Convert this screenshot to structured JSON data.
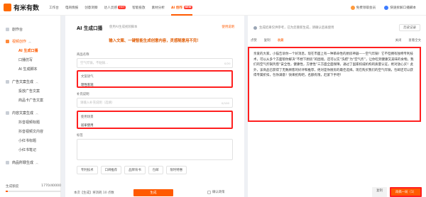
{
  "app": {
    "logo_text": "有米有数",
    "brand_color": "#ff5a00"
  },
  "nav": [
    {
      "label": "工作台"
    },
    {
      "label": "电商情报"
    },
    {
      "label": "创意洞察"
    },
    {
      "label": "达人灵感",
      "badge": "HOT"
    },
    {
      "label": "智能投放"
    },
    {
      "label": "素材分析"
    },
    {
      "label": "AI 创作",
      "badge": "NEW",
      "active": true
    }
  ],
  "topright": {
    "promo": "免费领取会员",
    "plugin": "快速拆解口播脚本"
  },
  "sidebar": {
    "items": [
      {
        "label": "創作台",
        "icon": "home-icon"
      },
      {
        "label": "视频创作",
        "icon": "video-icon",
        "group": true
      },
      {
        "label": "AI 生成口播",
        "sub": true,
        "active": true
      },
      {
        "label": "口播仿写",
        "sub": true
      },
      {
        "label": "AI 生成脚本",
        "sub": true
      },
      {
        "label": "广告文案生成",
        "icon": "ad-icon",
        "group": true
      },
      {
        "label": "投放广告文案",
        "sub": true
      },
      {
        "label": "商品卡广告文案",
        "sub": true
      },
      {
        "label": "内容文案生成",
        "icon": "content-icon",
        "group": true
      },
      {
        "label": "抖音视频标题",
        "sub": true
      },
      {
        "label": "抖音视频文内容",
        "sub": true
      },
      {
        "label": "小红书标题",
        "sub": true
      },
      {
        "label": "小红书笔记",
        "sub": true
      },
      {
        "label": "商品所罪生成",
        "icon": "goods-icon",
        "group": true
      }
    ],
    "quota_label": "生成额度",
    "quota_value": "1770/40000",
    "quota_fraction": 0.04
  },
  "main": {
    "title": "AI 生成口播",
    "subtitle": "使用AI生成视频脚本",
    "link": "使用说明",
    "banner": "输入文案、一键智能生成创意内容，灵感随意用不完！",
    "product_label": "商品名称",
    "product_placeholder": "空气炸锅，不粘锅...",
    "product_counter": "0/20",
    "style_label": "文案语气",
    "style_value": "理性客观",
    "extra_label": "补充说明",
    "extra_placeholder": "请输入补充说明（选填）",
    "extra_counter": "0/100",
    "scene_label": "使用场景",
    "scene_value": "居家使用",
    "tags_label": "标签",
    "tags": [
      "专利技术",
      "口碑推荐",
      "品牌背书",
      "包邮",
      "限时特惠"
    ],
    "footer_text": "本次【生成】将消耗 10 点数",
    "generate_button": "生成",
    "agree_label": "确认政策"
  },
  "right": {
    "notice": "生成结果仅供参考，已为您重新生成，请确认后再使用",
    "top_button": "历史记录",
    "tools": [
      "点赞",
      "复制",
      "收藏"
    ],
    "tools_right": [
      "关闭",
      "查看全文"
    ],
    "result_text": "亲爱的大家，小猫告诉你一个好消息，现在市面上有一种革命性的厨房神器——空气炸锅！它不但拥有独特专利技术，可以从多个方面帮你解决“不想下厨房”的困境。还可以实“洗把”为“空气炸”，让你吃到健康又美味的食物。我们的空气炸锅凭借“安全性，健康性，方便性”三方面全面保障，通过了国家权威机构的质量认证，绝对放心买！此外，该商品已获得了无数顾客的好评和推荐，绝对是你厨房的最佳选择。现在购买我们的空气炸锅，包邮还可以获得专属折扣，包你满意！快来抢购吧，名额有限，赶紧下手吧！",
    "bottom_buttons": [
      "复制",
      "再搞一局（1）"
    ]
  }
}
